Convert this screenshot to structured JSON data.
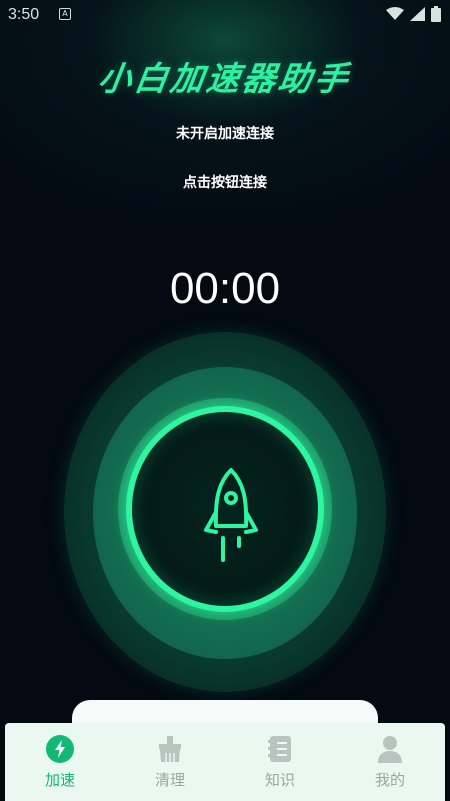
{
  "status_bar": {
    "time": "3:50",
    "notification_icon": "A"
  },
  "app": {
    "title": "小白加速器助手"
  },
  "connection": {
    "status_text": "未开启加速连接",
    "hint_text": "点击按钮连接",
    "timer": "00:00"
  },
  "tabs": [
    {
      "label": "加速",
      "icon": "lightning-icon",
      "active": true
    },
    {
      "label": "清理",
      "icon": "broom-icon",
      "active": false
    },
    {
      "label": "知识",
      "icon": "notebook-icon",
      "active": false
    },
    {
      "label": "我的",
      "icon": "person-icon",
      "active": false
    }
  ],
  "colors": {
    "accent": "#2df5a1",
    "active_tab": "#13b877",
    "inactive_tab": "#9aa7a3",
    "background": "#030a12"
  }
}
